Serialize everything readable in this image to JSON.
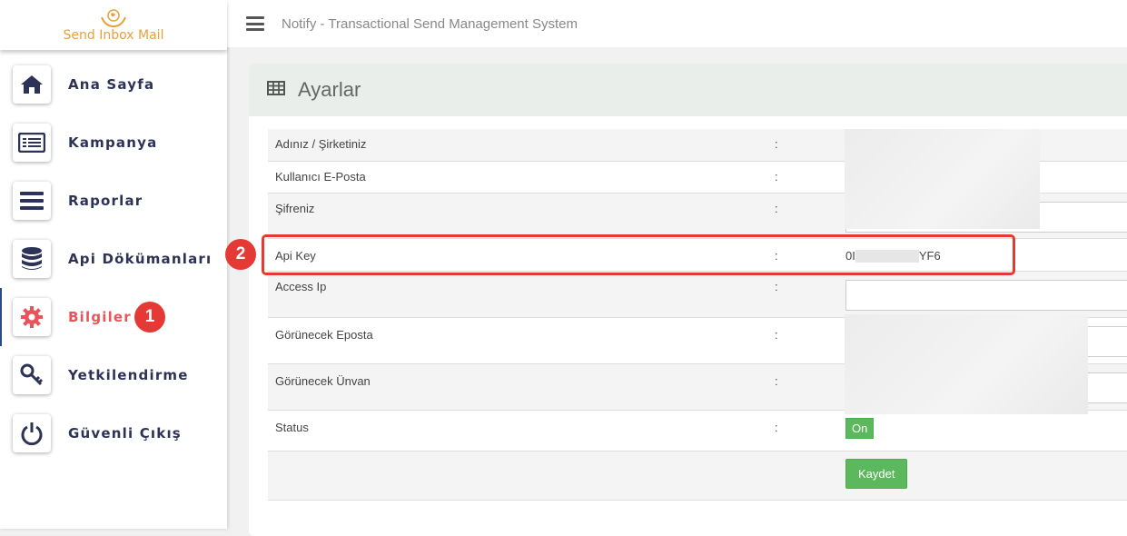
{
  "logo": {
    "text": "Send Inbox Mail",
    "icon": "hands-globe-logo"
  },
  "topbar": {
    "title": "Notify - Transactional Send Management System"
  },
  "sidebar": {
    "items": [
      {
        "label": "Ana Sayfa",
        "icon": "home-icon"
      },
      {
        "label": "Kampanya",
        "icon": "list-card-icon"
      },
      {
        "label": "Raporlar",
        "icon": "bars-icon"
      },
      {
        "label": "Api Dökümanları",
        "icon": "database-icon"
      },
      {
        "label": "Bilgiler",
        "icon": "gear-icon"
      },
      {
        "label": "Yetkilendirme",
        "icon": "key-icon"
      },
      {
        "label": "Güvenli Çıkış",
        "icon": "power-icon"
      }
    ],
    "active": "Bilgiler"
  },
  "annotations": {
    "badge1": "1",
    "badge2": "2"
  },
  "panel": {
    "title": "Ayarlar",
    "icon": "table-icon"
  },
  "form": {
    "colon": ":",
    "rows": [
      {
        "label": "Adınız / Şirketiniz"
      },
      {
        "label": "Kullanıcı E-Posta"
      },
      {
        "label": "Şifreniz"
      },
      {
        "label": "Api Key",
        "value_start": "0I",
        "value_end": "YF6"
      },
      {
        "label": "Access Ip"
      },
      {
        "label": "Görünecek Eposta"
      },
      {
        "label": "Görünecek Ünvan"
      },
      {
        "label": "Status",
        "button": "On"
      }
    ],
    "save_label": "Kaydet"
  },
  "colors": {
    "accent": "#e53935",
    "active": "#e8545a",
    "button": "#5cb85c",
    "nav_text": "#2c3357"
  }
}
